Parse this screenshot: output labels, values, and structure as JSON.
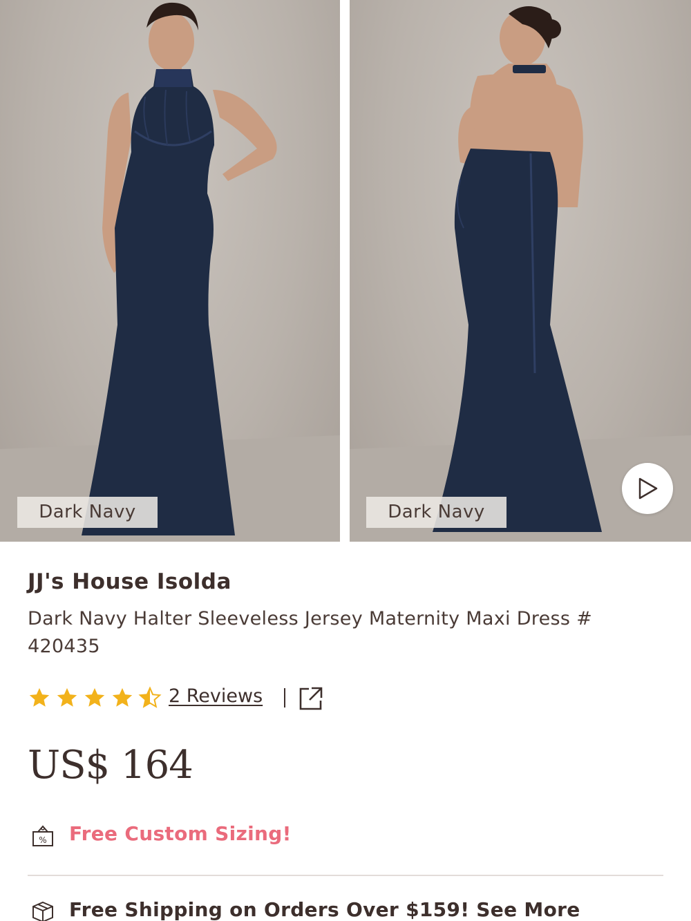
{
  "gallery": {
    "images": [
      {
        "color_tag": "Dark Navy",
        "alt": "front view"
      },
      {
        "color_tag": "Dark Navy",
        "alt": "back view"
      }
    ],
    "video_icon": "play-icon"
  },
  "product": {
    "brand": "JJ's House Isolda",
    "name": "Dark Navy Halter Sleeveless Jersey Maternity Maxi Dress # 420435",
    "rating": 4.5,
    "rating_max": 5,
    "reviews_label": "2 Reviews",
    "price": "US$ 164"
  },
  "perks": {
    "sizing": {
      "label": "Free Custom Sizing!",
      "icon": "discount-bag-icon"
    },
    "shipping": {
      "label": "Free Shipping on Orders Over $159! See More",
      "icon": "shipping-box-icon"
    }
  },
  "colors": {
    "star": "#f2b21b",
    "accent_pink": "#ea6b7c",
    "text_dark": "#3d2f2c",
    "dress_navy": "#1f2c44"
  }
}
